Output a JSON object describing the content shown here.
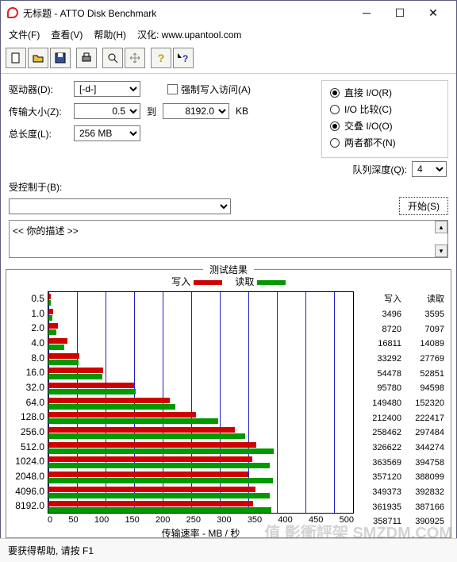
{
  "window": {
    "title": "无标题 - ATTO Disk Benchmark"
  },
  "menu": {
    "file": "文件(F)",
    "view": "查看(V)",
    "help": "帮助(H)",
    "localize": "汉化: www.upantool.com"
  },
  "form": {
    "drive_label": "驱动器(D):",
    "drive_value": "[-d-]",
    "force_write": "强制写入访问(A)",
    "xfer_label": "传输大小(Z):",
    "xfer_from": "0.5",
    "xfer_to_label": "到",
    "xfer_to": "8192.0",
    "xfer_unit": "KB",
    "total_label": "总长度(L):",
    "total_value": "256 MB",
    "direct_io": "直接 I/O(R)",
    "io_compare": "I/O 比较(C)",
    "overlap": "交叠 I/O(O)",
    "neither": "两者都不(N)",
    "queue_label": "队列深度(Q):",
    "queue_value": "4",
    "controlled_label": "受控制于(B):",
    "start_btn": "开始(S)",
    "desc": "<<   你的描述   >>"
  },
  "results": {
    "title": "测试结果",
    "write_legend": "写入",
    "read_legend": "读取",
    "write_col": "写入",
    "read_col": "读取",
    "xlabel": "传输速率 - MB / 秒"
  },
  "chart_data": {
    "type": "bar",
    "orientation": "horizontal",
    "categories": [
      "0.5",
      "1.0",
      "2.0",
      "4.0",
      "8.0",
      "16.0",
      "32.0",
      "64.0",
      "128.0",
      "256.0",
      "512.0",
      "1024.0",
      "2048.0",
      "4096.0",
      "8192.0"
    ],
    "series": [
      {
        "name": "写入",
        "color": "#d00000",
        "values": [
          3496,
          8720,
          16811,
          33292,
          54478,
          95780,
          149480,
          212400,
          258462,
          326622,
          363569,
          357120,
          349373,
          361935,
          358711
        ]
      },
      {
        "name": "读取",
        "color": "#009a00",
        "values": [
          3595,
          7097,
          14089,
          27769,
          52851,
          94598,
          152320,
          222417,
          297484,
          344274,
          394758,
          388099,
          392832,
          387166,
          390925
        ]
      }
    ],
    "xlim": [
      0,
      500
    ],
    "xticks": [
      0,
      50,
      100,
      150,
      200,
      250,
      300,
      350,
      400,
      450,
      500
    ],
    "xlabel": "传输速率 - MB / 秒",
    "ylabel": ""
  },
  "status": "要获得帮助, 请按 F1",
  "watermark": "值 影衝評架 SMZDM.COM"
}
